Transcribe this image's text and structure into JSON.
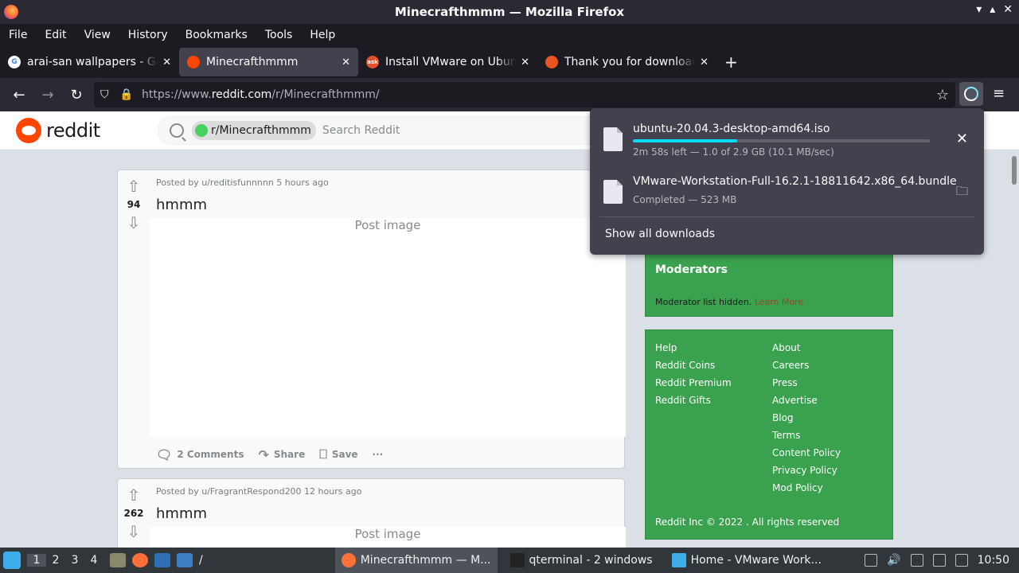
{
  "window": {
    "title": "Minecrafthmmm — Mozilla Firefox",
    "controls": [
      "▾",
      "▴",
      "✕"
    ]
  },
  "menu": [
    "File",
    "Edit",
    "View",
    "History",
    "Bookmarks",
    "Tools",
    "Help"
  ],
  "tabs": [
    {
      "label": "arai-san wallpapers - Goo",
      "icon_color": "#ffffff",
      "icon_text": "G",
      "active": false
    },
    {
      "label": "Minecrafthmmm",
      "icon_color": "#ff4500",
      "icon_text": "",
      "active": true
    },
    {
      "label": "Install VMware on Ubuntu",
      "icon_color": "#e0502b",
      "icon_text": "ask",
      "active": false
    },
    {
      "label": "Thank you for downloadi",
      "icon_color": "#e95420",
      "icon_text": "",
      "active": false
    }
  ],
  "nav": {
    "url_prefix": "https://www.",
    "url_domain": "reddit.com",
    "url_path": "/r/Minecrafthmmm/"
  },
  "reddit": {
    "wordmark": "reddit",
    "search_chip": "r/Minecrafthmmm",
    "search_chip_alt": "Subreddit Icon",
    "search_placeholder": "Search Reddit"
  },
  "posts": [
    {
      "votes": "94",
      "meta": "Posted by u/reditisfunnnnn 5 hours ago",
      "title": "hmmm",
      "media_alt": "Post image",
      "comments": "2 Comments",
      "share": "Share",
      "save": "Save"
    },
    {
      "votes": "262",
      "meta": "Posted by u/FragrantRespond200 12 hours ago",
      "title": "hmmm",
      "media_alt": "Post image"
    }
  ],
  "sidebar": {
    "moderators_title": "Moderators",
    "moderators_text": "Moderator list hidden.",
    "learn_more": "Learn More",
    "links_left": [
      "Help",
      "Reddit Coins",
      "Reddit Premium",
      "Reddit Gifts"
    ],
    "links_right": [
      "About",
      "Careers",
      "Press",
      "Advertise",
      "Blog",
      "Terms",
      "Content Policy",
      "Privacy Policy",
      "Mod Policy"
    ],
    "copyright": "Reddit Inc © 2022 . All rights reserved"
  },
  "downloads": {
    "items": [
      {
        "name": "ubuntu-20.04.3-desktop-amd64.iso",
        "status": "2m 58s left — 1.0 of 2.9 GB (10.1 MB/sec)",
        "progress": 0.35,
        "action": "✕"
      },
      {
        "name": "VMware-Workstation-Full-16.2.1-18811642.x86_64.bundle",
        "status": "Completed — 523 MB",
        "action": "🗀"
      }
    ],
    "show_all": "Show all downloads"
  },
  "taskbar": {
    "workspaces": [
      "1",
      "2",
      "3",
      "4"
    ],
    "path": "/",
    "tasks": [
      {
        "label": "Minecrafthmmm — M...",
        "active": true,
        "icon_color": "#ff7139"
      },
      {
        "label": "qterminal - 2 windows",
        "active": false,
        "icon_color": "#222222"
      },
      {
        "label": "Home - VMware Work...",
        "active": false,
        "icon_color": "#3daee9"
      }
    ],
    "clock": "10:50"
  }
}
